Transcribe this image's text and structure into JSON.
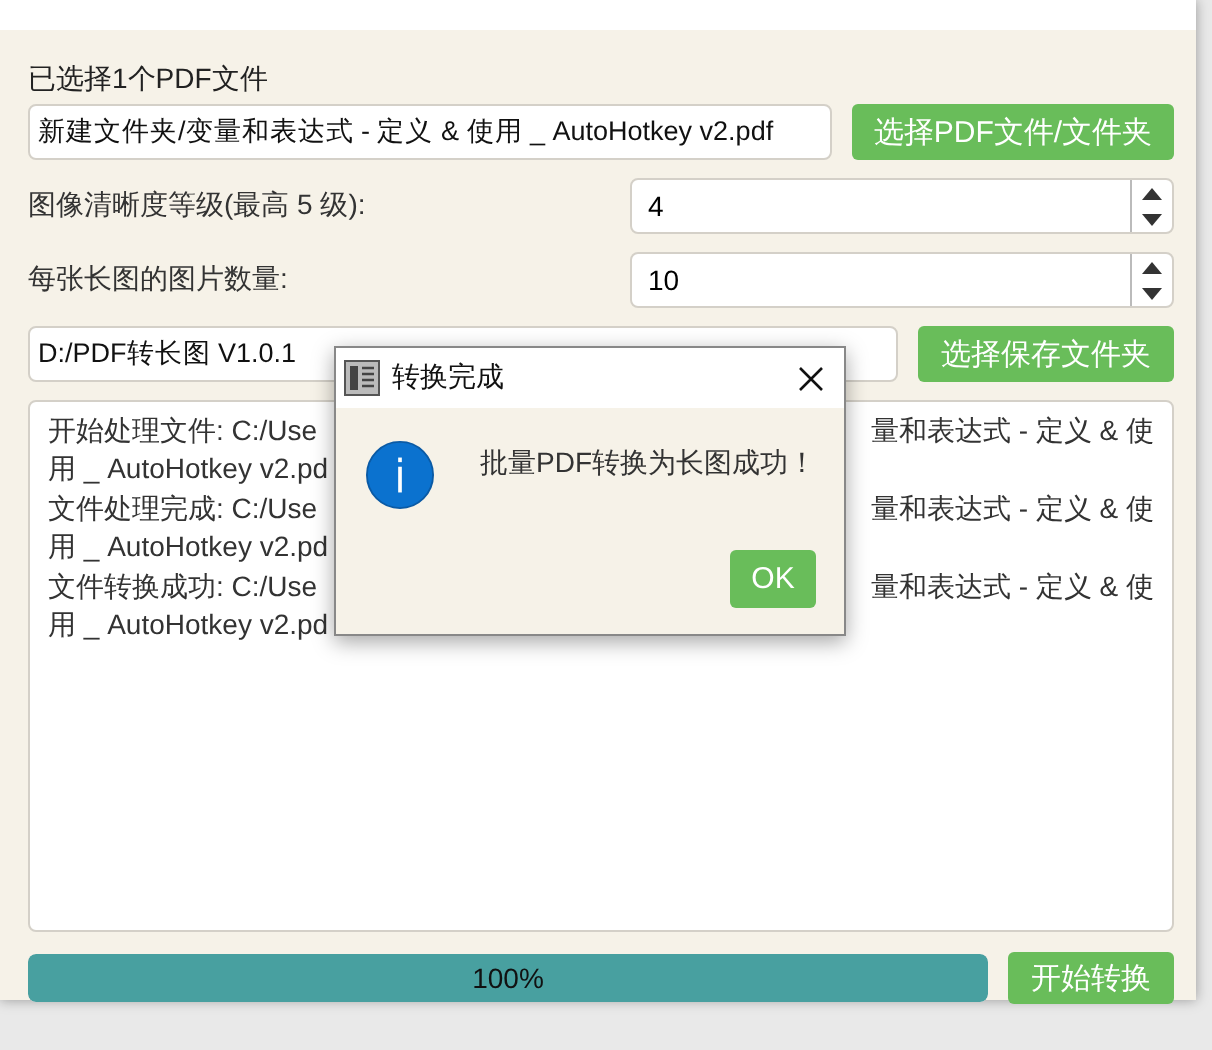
{
  "selection_label": "已选择1个PDF文件",
  "file_path": {
    "value": "新建文件夹/变量和表达式 - 定义 & 使用 _ AutoHotkey v2.pdf"
  },
  "select_pdf_button": "选择PDF文件/文件夹",
  "settings": [
    {
      "label": "图像清晰度等级(最高 5 级):",
      "value": "4"
    },
    {
      "label": "每张长图的图片数量:",
      "value": "10"
    }
  ],
  "output_path": {
    "value": "D:/PDF转长图 V1.0.1"
  },
  "select_folder_button": "选择保存文件夹",
  "log": [
    {
      "left": "开始处理文件: C:/Use",
      "right": "量和表达式 - 定义 & 使"
    },
    {
      "left": "用 _ AutoHotkey v2.pd"
    },
    {
      "left": "文件处理完成: C:/Use",
      "right": "量和表达式 - 定义 & 使"
    },
    {
      "left": "用 _ AutoHotkey v2.pd"
    },
    {
      "left": "文件转换成功: C:/Use",
      "right": "量和表达式 - 定义 & 使"
    },
    {
      "left": "用 _ AutoHotkey v2.pd"
    }
  ],
  "progress": {
    "level": 1,
    "reading": "100%"
  },
  "start_button": "开始转换",
  "dialog": {
    "title": "转换完成",
    "message": "批量PDF转换为长图成功！",
    "ok_button": "OK"
  }
}
